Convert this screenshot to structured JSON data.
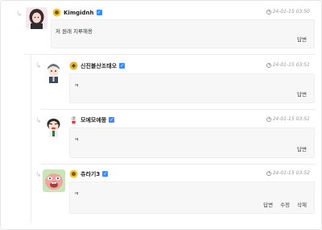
{
  "comments": [
    {
      "nickname": "Kimgidnh",
      "verified_icon": "✓",
      "timestamp": "24-01-15 03:50",
      "text": "저 원래 지루해용",
      "actions": [
        "답변"
      ]
    },
    {
      "nickname": "신진블산조태오",
      "verified_icon": "✓",
      "timestamp": "24-01-15 03:51",
      "text": "ㅋ",
      "actions": [
        "답변"
      ]
    },
    {
      "nickname": "모에모에쫑",
      "verified_icon": "✓",
      "timestamp": "24-01-15 03:51",
      "text": "ㅋ",
      "actions": [
        "답변"
      ]
    },
    {
      "nickname": "츄라기3",
      "verified_icon": "✓",
      "timestamp": "24-01-15 03:52",
      "text": "ㅋ",
      "actions": [
        "답변",
        "수정",
        "삭제"
      ]
    }
  ],
  "reply_arrow_icon": "↳",
  "colors": {
    "verified": "#3d8cff",
    "box_bg": "#f7f7f8",
    "meta": "#999999"
  }
}
